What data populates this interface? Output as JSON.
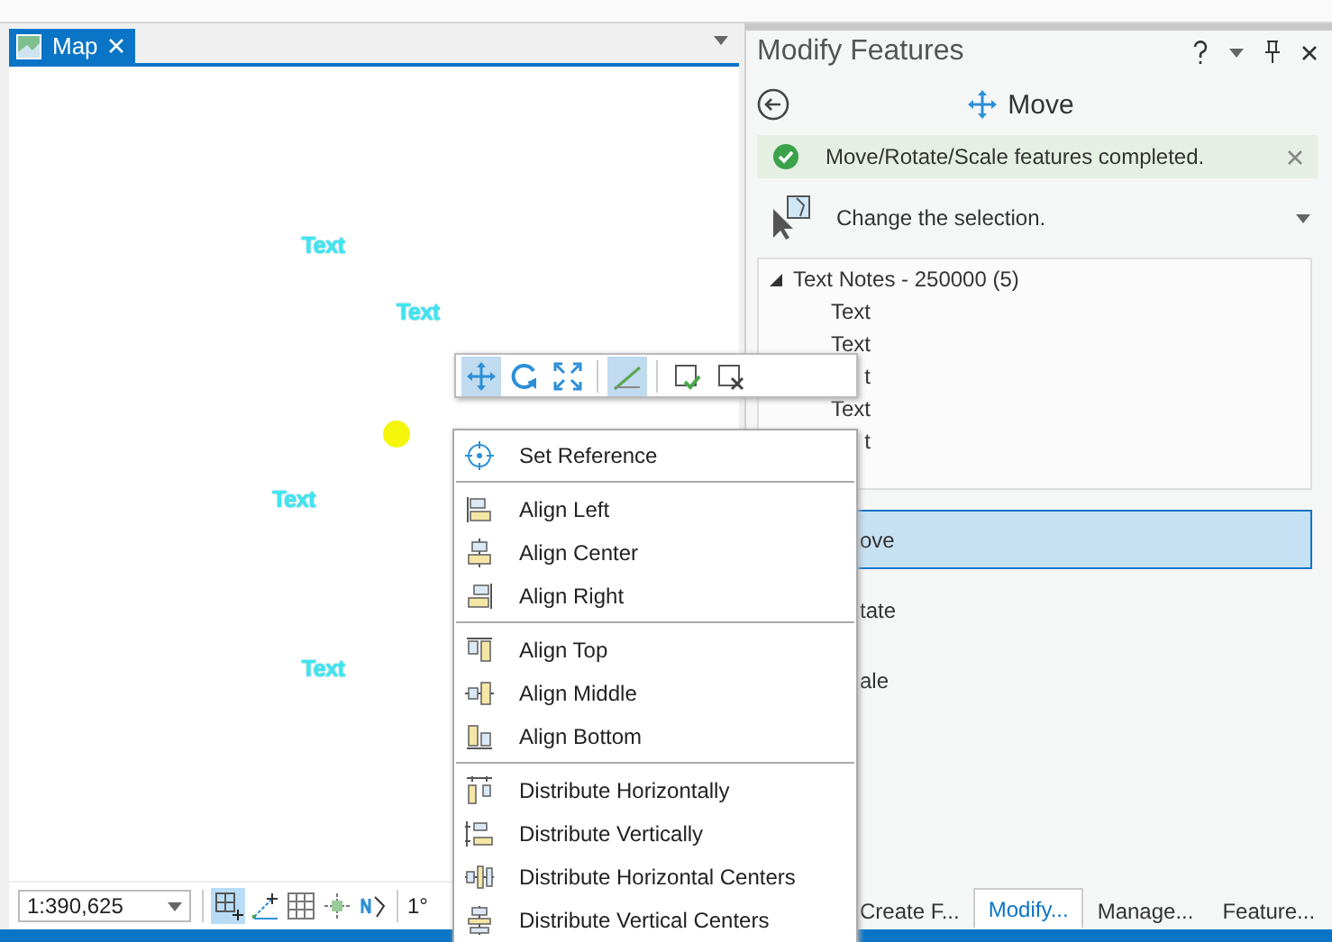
{
  "map_tab": {
    "label": "Map",
    "selected": true
  },
  "map_labels": [
    "Text",
    "Text",
    "Text",
    "Text"
  ],
  "floating_toolbar": {
    "buttons": [
      {
        "selected": true
      },
      {
        "selected": false
      },
      {
        "selected": false
      },
      {
        "selected": true
      },
      {
        "selected": false
      },
      {
        "selected": false
      }
    ]
  },
  "context_menu": {
    "groups": [
      [
        "Set Reference"
      ],
      [
        "Align Left",
        "Align Center",
        "Align Right"
      ],
      [
        "Align Top",
        "Align Middle",
        "Align Bottom"
      ],
      [
        "Distribute Horizontally",
        "Distribute Vertically",
        "Distribute Horizontal Centers",
        "Distribute Vertical Centers"
      ]
    ]
  },
  "status_bar": {
    "scale": "1:390,625",
    "tools": [
      {
        "selected": true
      },
      {
        "selected": false
      },
      {
        "selected": false
      },
      {
        "selected": false
      },
      {
        "selected": false
      }
    ],
    "rotation": "1°"
  },
  "panel": {
    "title": "Modify Features",
    "tool_title": "Move",
    "message": "Move/Rotate/Scale features completed.",
    "selection": "Change the selection.",
    "tree": {
      "label": "Text Notes - 250000 (5)",
      "expanded": true,
      "children": [
        "Text",
        "Text",
        "t",
        "Text",
        "t"
      ]
    },
    "tools": [
      {
        "label": "ove",
        "selected": true
      },
      {
        "label": "tate",
        "selected": false
      },
      {
        "label": "ale",
        "selected": false
      }
    ],
    "tabs": [
      {
        "label": "Create F...",
        "selected": false
      },
      {
        "label": "Modify...",
        "selected": true
      },
      {
        "label": "Manage...",
        "selected": false
      },
      {
        "label": "Feature...",
        "selected": false
      }
    ]
  }
}
